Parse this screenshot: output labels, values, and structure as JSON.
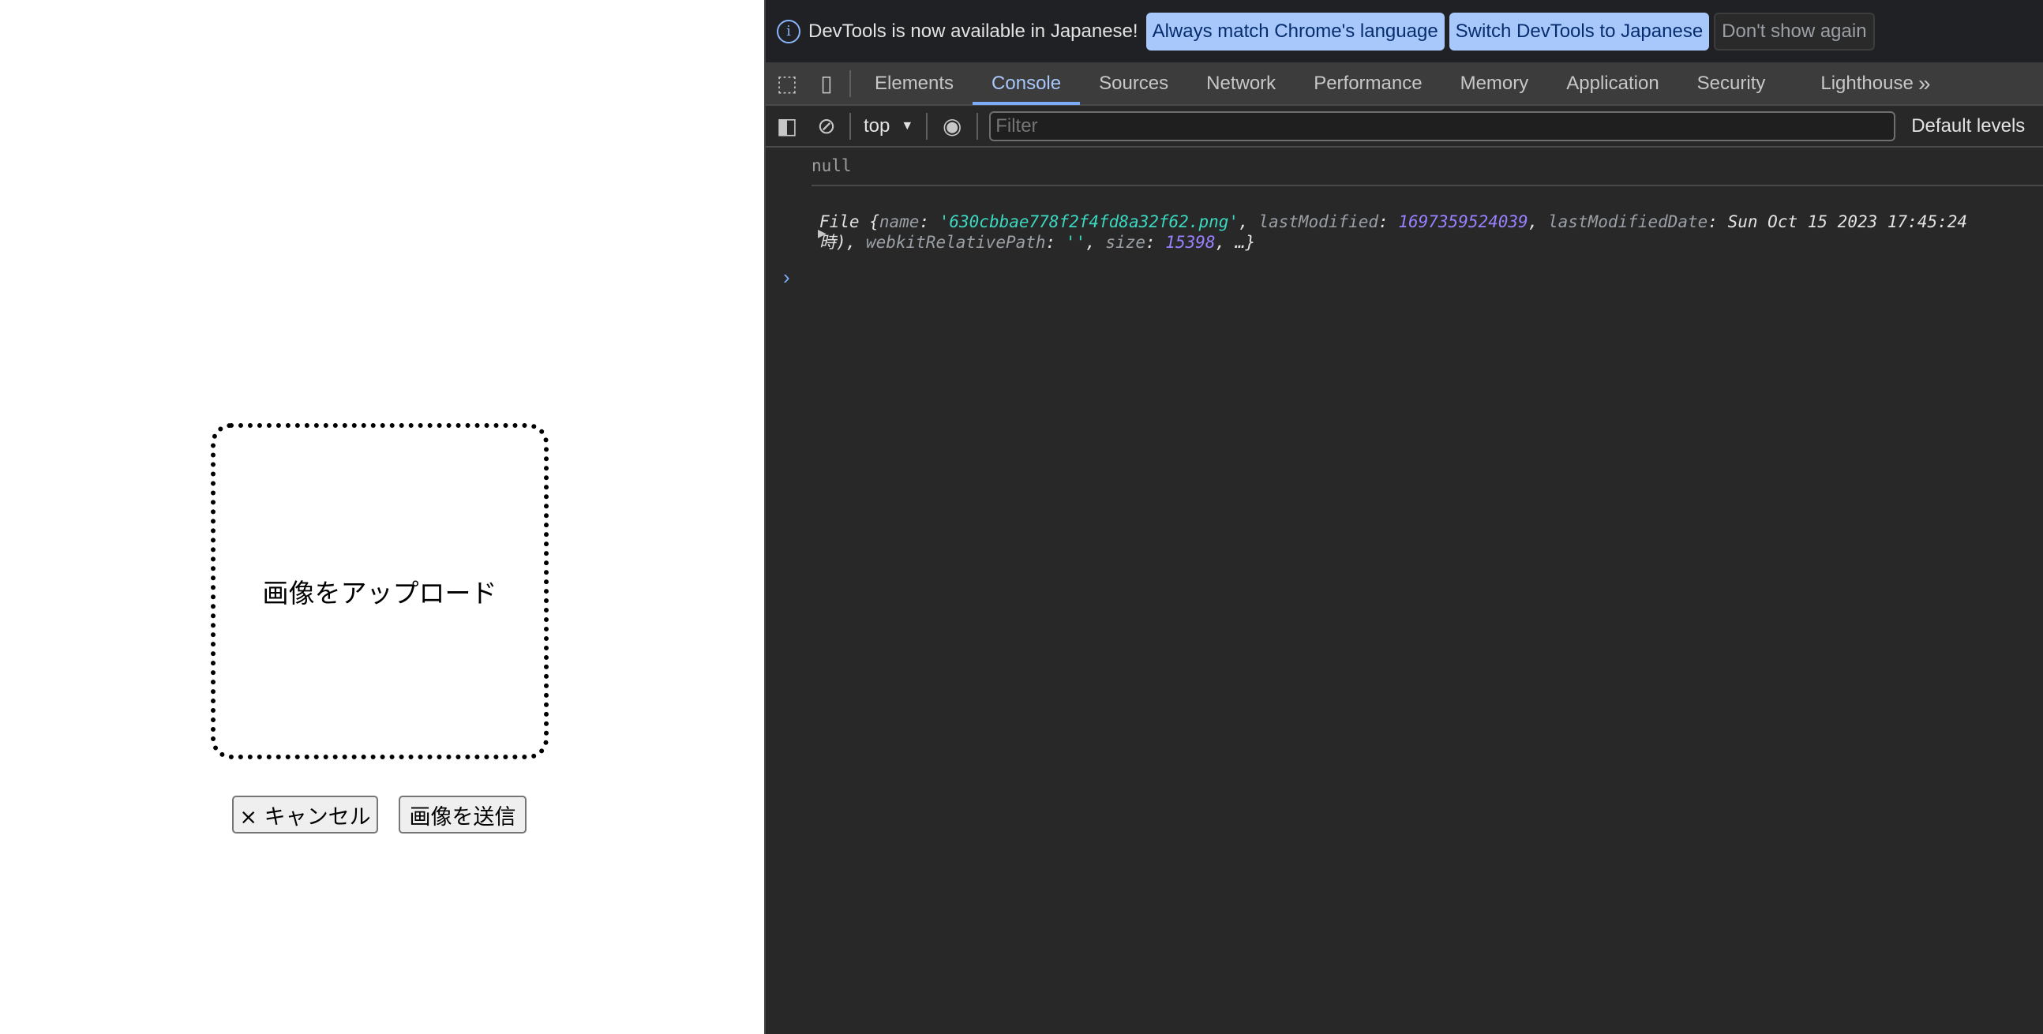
{
  "page": {
    "dropzone_label": "画像をアップロード",
    "cancel_label": "× キャンセル",
    "send_label": "画像を送信"
  },
  "devtools": {
    "infobar": {
      "message": "DevTools is now available in Japanese!",
      "btn_match": "Always match Chrome's language",
      "btn_switch": "Switch DevTools to Japanese",
      "btn_dismiss": "Don't show again"
    },
    "tabs": [
      "Elements",
      "Console",
      "Sources",
      "Network",
      "Performance",
      "Memory",
      "Application",
      "Security",
      "Lighthouse"
    ],
    "active_tab": "Console",
    "toolbar": {
      "context": "top",
      "filter_placeholder": "Filter",
      "levels": "Default levels"
    },
    "console": {
      "null_line": "null",
      "file": {
        "prefix": "File {",
        "k_name": "name",
        "v_name": "'630cbbae778f2f4fd8a32f62.png'",
        "k_lastModified": "lastModified",
        "v_lastModified": "1697359524039",
        "k_lastModifiedDate": "lastModifiedDate",
        "v_lastModifiedDate": "Sun Oct 15 2023 17:45:24",
        "line2_start": "時),",
        "k_path": "webkitRelativePath",
        "v_path": "''",
        "k_size": "size",
        "v_size": "15398",
        "suffix": ", …}"
      }
    }
  }
}
